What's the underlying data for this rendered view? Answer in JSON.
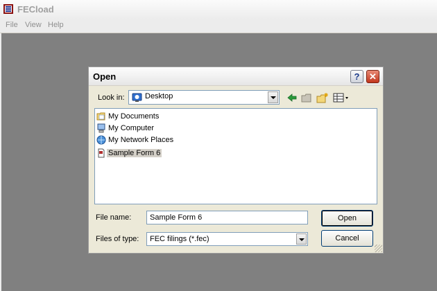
{
  "app": {
    "title": "FECload",
    "menu": [
      "File",
      "View",
      "Help"
    ]
  },
  "dialog": {
    "title": "Open",
    "help_glyph": "?",
    "close_glyph": "✕",
    "look_in_label": "Look in:",
    "look_in_value": "Desktop",
    "items": [
      {
        "name": "My Documents",
        "icon": "folder-icon"
      },
      {
        "name": "My Computer",
        "icon": "computer-icon"
      },
      {
        "name": "My Network Places",
        "icon": "network-icon"
      },
      {
        "name": "Sample Form 6",
        "icon": "document-icon",
        "selected": true
      }
    ],
    "file_name_label": "File name:",
    "file_name_value": "Sample Form 6",
    "files_of_type_label": "Files of type:",
    "files_of_type_value": "FEC filings (*.fec)",
    "open_label": "Open",
    "cancel_label": "Cancel"
  },
  "colors": {
    "client_bg": "#808080",
    "dialog_bg": "#ece9d8",
    "close_red": "#c2361c",
    "accent_blue": "#7f9db9"
  }
}
